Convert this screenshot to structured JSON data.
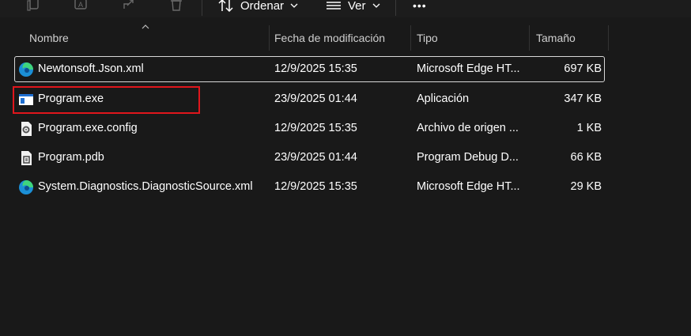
{
  "toolbar": {
    "sort_label": "Ordenar",
    "view_label": "Ver",
    "more_label": "•••"
  },
  "columns": {
    "name": "Nombre",
    "modified": "Fecha de modificación",
    "type": "Tipo",
    "size": "Tamaño"
  },
  "files": [
    {
      "name": "Newtonsoft.Json.xml",
      "modified": "12/9/2025 15:35",
      "type": "Microsoft Edge HT...",
      "size": "697 KB",
      "icon": "edge-icon"
    },
    {
      "name": "Program.exe",
      "modified": "23/9/2025 01:44",
      "type": "Aplicación",
      "size": "347 KB",
      "icon": "exe-icon"
    },
    {
      "name": "Program.exe.config",
      "modified": "12/9/2025 15:35",
      "type": "Archivo de origen ...",
      "size": "1 KB",
      "icon": "config-icon"
    },
    {
      "name": "Program.pdb",
      "modified": "23/9/2025 01:44",
      "type": "Program Debug D...",
      "size": "66 KB",
      "icon": "pdb-icon"
    },
    {
      "name": "System.Diagnostics.DiagnosticSource.xml",
      "modified": "12/9/2025 15:35",
      "type": "Microsoft Edge HT...",
      "size": "29 KB",
      "icon": "edge-icon"
    }
  ],
  "colors": {
    "background": "#191919",
    "selection_border": "#d8d8d8",
    "highlight": "#e0161c"
  }
}
